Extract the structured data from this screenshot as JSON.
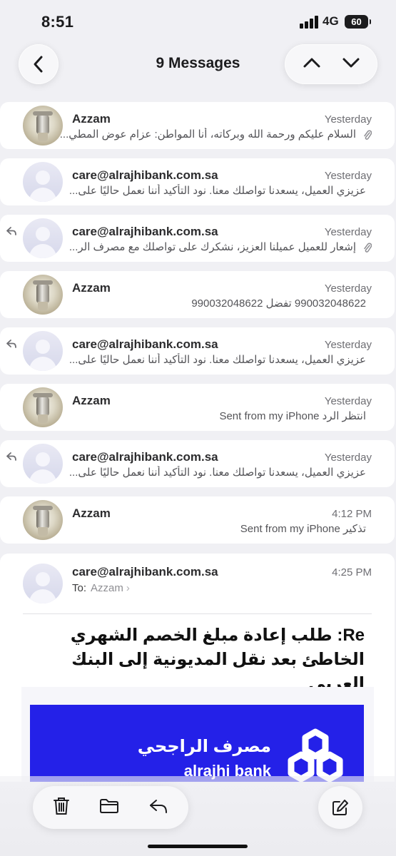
{
  "status_bar": {
    "time": "8:51",
    "network": "4G",
    "battery": "60"
  },
  "nav": {
    "title": "9 Messages",
    "back_icon": "chevron-left-icon",
    "up_icon": "chevron-up-icon",
    "down_icon": "chevron-down-icon"
  },
  "messages": [
    {
      "sender": "Azzam",
      "time": "Yesterday",
      "preview": "السلام عليكم ورحمة الله وبركاته، أنا المواطن: عزام عوض المطي...",
      "avatar": "photo",
      "attachment": true,
      "replied": false
    },
    {
      "sender": "care@alrajhibank.com.sa",
      "time": "Yesterday",
      "preview": "عزيزي العميل، يسعدنا تواصلك معنا. نود التأكيد أننا نعمل حاليًا على...",
      "avatar": "default",
      "attachment": false,
      "replied": false
    },
    {
      "sender": "care@alrajhibank.com.sa",
      "time": "Yesterday",
      "preview": "إشعار للعميل عميلنا العزيز، نشكرك على تواصلك مع مصرف الر...",
      "avatar": "default",
      "attachment": true,
      "replied": true
    },
    {
      "sender": "Azzam",
      "time": "Yesterday",
      "preview": "990032048622 تفضل 990032048622",
      "avatar": "photo",
      "attachment": false,
      "replied": false
    },
    {
      "sender": "care@alrajhibank.com.sa",
      "time": "Yesterday",
      "preview": "عزيزي العميل، يسعدنا تواصلك معنا. نود التأكيد أننا نعمل حاليًا على...",
      "avatar": "default",
      "attachment": false,
      "replied": true
    },
    {
      "sender": "Azzam",
      "time": "Yesterday",
      "preview": "انتظر الرد Sent from my iPhone",
      "avatar": "photo",
      "attachment": false,
      "replied": false
    },
    {
      "sender": "care@alrajhibank.com.sa",
      "time": "Yesterday",
      "preview": "عزيزي العميل، يسعدنا تواصلك معنا. نود التأكيد أننا نعمل حاليًا على...",
      "avatar": "default",
      "attachment": false,
      "replied": true
    },
    {
      "sender": "Azzam",
      "time": "4:12 PM",
      "preview": "تذكير Sent from my iPhone",
      "avatar": "photo",
      "attachment": false,
      "replied": false
    }
  ],
  "expanded": {
    "sender": "care@alrajhibank.com.sa",
    "time": "4:25 PM",
    "to_label": "To:",
    "to": "Azzam",
    "subject": "Re: طلب إعادة مبلغ الخصم الشهري الخاطئ بعد نقل المديونية إلى البنك العربي",
    "bank_name_ar": "مصرف الراجحي",
    "bank_name_en": "alrajhi bank"
  },
  "toolbar": {
    "delete_icon": "trash-icon",
    "move_icon": "folder-icon",
    "reply_icon": "reply-icon",
    "compose_icon": "compose-icon"
  }
}
